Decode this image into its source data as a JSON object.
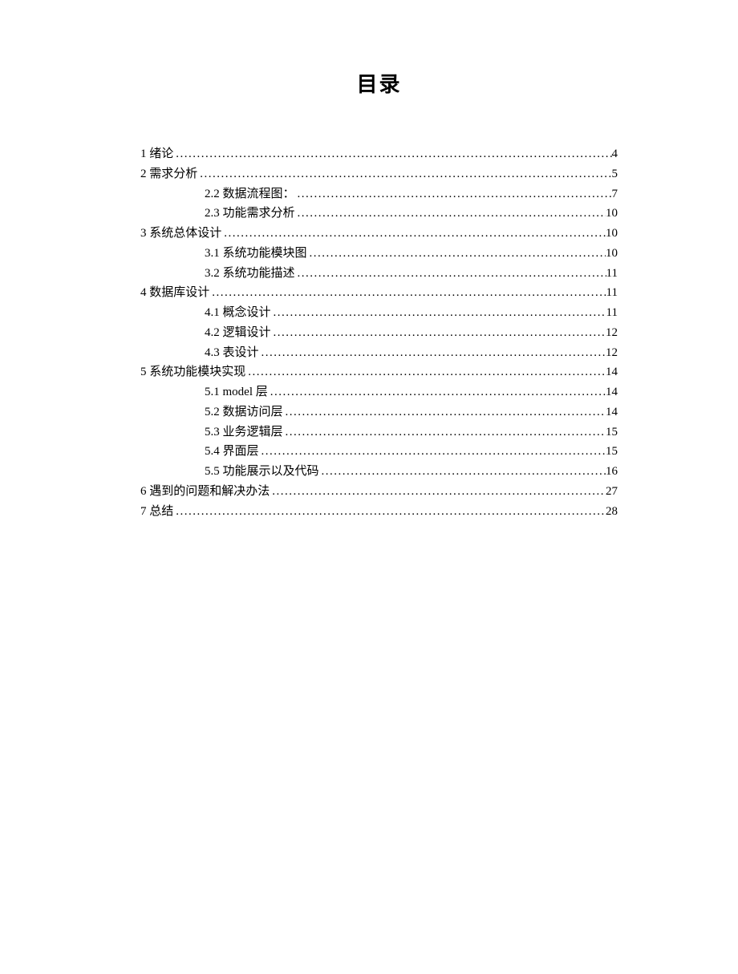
{
  "title": "目录",
  "entries": [
    {
      "level": 1,
      "label": "1 绪论",
      "page": "4"
    },
    {
      "level": 1,
      "label": "2 需求分析",
      "page": "5"
    },
    {
      "level": 2,
      "label": "2.2 数据流程图：",
      "page": "7"
    },
    {
      "level": 2,
      "label": "2.3 功能需求分析",
      "page": "10"
    },
    {
      "level": 1,
      "label": "3 系统总体设计",
      "page": "10"
    },
    {
      "level": 2,
      "label": "3.1 系统功能模块图",
      "page": "10"
    },
    {
      "level": 2,
      "label": "3.2 系统功能描述",
      "page": "11"
    },
    {
      "level": 1,
      "label": "4 数据库设计",
      "page": "11"
    },
    {
      "level": 2,
      "label": "4.1 概念设计",
      "page": "11"
    },
    {
      "level": 2,
      "label": "4.2 逻辑设计",
      "page": "12"
    },
    {
      "level": 2,
      "label": "4.3 表设计",
      "page": "12"
    },
    {
      "level": 1,
      "label": "5 系统功能模块实现",
      "page": "14"
    },
    {
      "level": 2,
      "label": "5.1 model 层",
      "page": "14"
    },
    {
      "level": 2,
      "label": "5.2 数据访问层",
      "page": "14"
    },
    {
      "level": 2,
      "label": "5.3 业务逻辑层",
      "page": "15"
    },
    {
      "level": 2,
      "label": "5.4 界面层",
      "page": "15"
    },
    {
      "level": 2,
      "label": "5.5 功能展示以及代码",
      "page": "16"
    },
    {
      "level": 1,
      "label": "6 遇到的问题和解决办法",
      "page": "27"
    },
    {
      "level": 1,
      "label": "7 总结",
      "page": "28"
    }
  ]
}
